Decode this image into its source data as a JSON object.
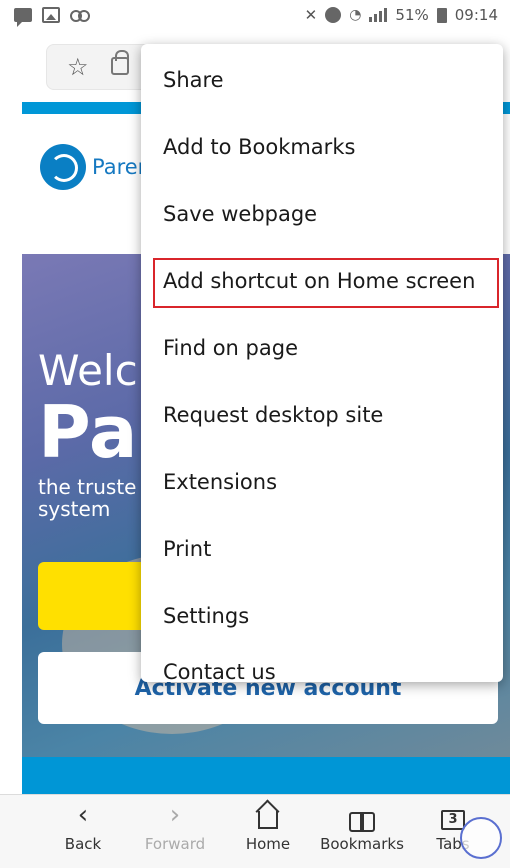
{
  "status_bar": {
    "battery": "51%",
    "time": "09:14"
  },
  "page": {
    "logo_text": "Paren",
    "hero_welcome": "Welc",
    "hero_brand": "Pa",
    "hero_tagline": "the truste system",
    "activate_button": "Activate new account"
  },
  "menu": {
    "items": [
      "Share",
      "Add to Bookmarks",
      "Save webpage",
      "Add shortcut on Home screen",
      "Find on page",
      "Request desktop site",
      "Extensions",
      "Print",
      "Settings",
      "Contact us"
    ],
    "highlighted": "Add shortcut on Home screen",
    "highlight_color": "#d9252b"
  },
  "bottom_nav": {
    "back": "Back",
    "forward": "Forward",
    "home": "Home",
    "bookmarks": "Bookmarks",
    "tabs": "Tabs",
    "tab_count": "3"
  },
  "colors": {
    "brand_blue": "#0097d7",
    "button_yellow": "#ffe000",
    "activate_text": "#1e63a8"
  },
  "icons": [
    "message-icon",
    "image-icon",
    "voicemail-icon",
    "mute-icon",
    "alarm-icon",
    "wifi-icon",
    "signal-icon",
    "battery-icon",
    "star-icon",
    "lock-icon",
    "back-icon",
    "forward-icon",
    "home-icon",
    "bookmarks-icon",
    "tabs-icon"
  ]
}
